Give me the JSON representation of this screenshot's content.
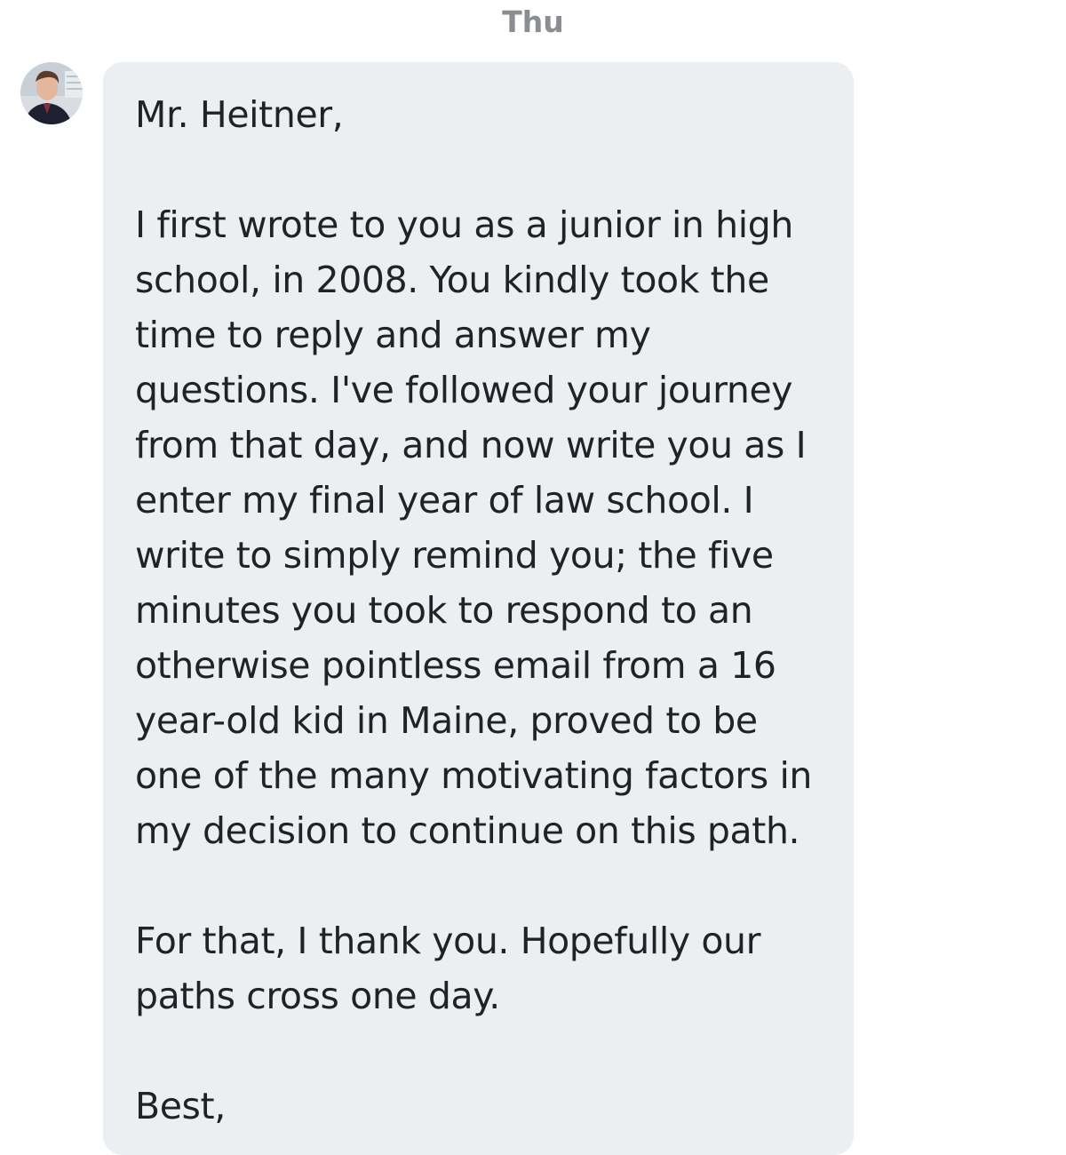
{
  "header": {
    "day_label": "Thu"
  },
  "message": {
    "sender_avatar": "profile-photo",
    "bubble_color": "#eceff2",
    "greeting": "Mr. Heitner,",
    "paragraph_1": [
      "I first wrote to you as a junior in high",
      "school, in 2008.  You kindly took the",
      "time to reply and answer my",
      "questions.  I've followed your journey",
      "from that day, and now write you as I",
      "enter my final year of law school.  I",
      "write to simply remind you; the five",
      "minutes you took to respond to an",
      "otherwise pointless email from a 16",
      "year-old kid in Maine, proved to be",
      "one of the many motivating factors in",
      "my decision to continue on this path."
    ],
    "paragraph_2": [
      "For that, I thank you.  Hopefully our",
      "paths cross one day."
    ],
    "closing": "Best,"
  }
}
